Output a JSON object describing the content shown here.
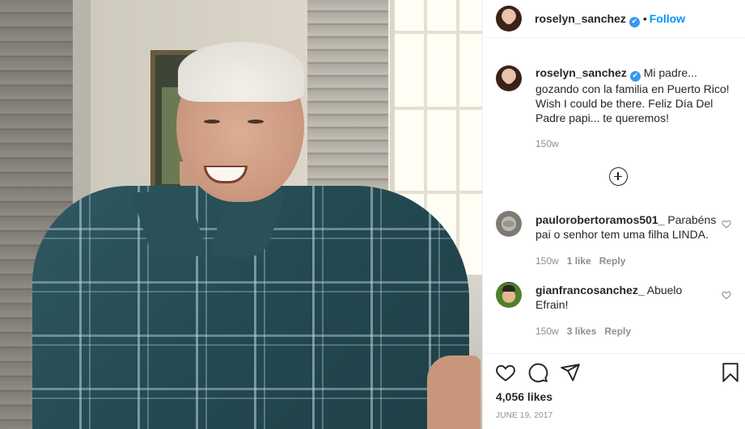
{
  "post": {
    "username": "roselyn_sanchez",
    "verified_glyph": "✔",
    "dot": "•",
    "follow_label": "Follow",
    "caption": {
      "username": "roselyn_sanchez",
      "text": "Mi padre... gozando con la familia en Puerto Rico! Wish I could be there. Feliz Día Del Padre papi... te queremos!",
      "time": "150w"
    },
    "load_more_icon": "plus-circle-icon",
    "comments": [
      {
        "username": "paulorobertoramos501_",
        "text": "Parabéns pai o senhor tem uma filha LINDA.",
        "time": "150w",
        "likes": "1 like",
        "reply_label": "Reply",
        "avatar": "cat-avatar"
      },
      {
        "username": "gianfrancosanchez_",
        "text": "Abuelo Efrain!",
        "time": "150w",
        "likes": "3 likes",
        "reply_label": "Reply",
        "avatar": "boy-avatar"
      }
    ],
    "actions": {
      "icons": [
        "heart-icon",
        "comment-icon",
        "share-icon",
        "bookmark-icon"
      ],
      "likes": "4,056 likes",
      "date": "JUNE 19, 2017"
    }
  },
  "colors": {
    "link_blue": "#0095f6",
    "verified_blue": "#3897f0",
    "text": "#262626",
    "muted": "#8e8e8e",
    "border": "#efefef"
  }
}
